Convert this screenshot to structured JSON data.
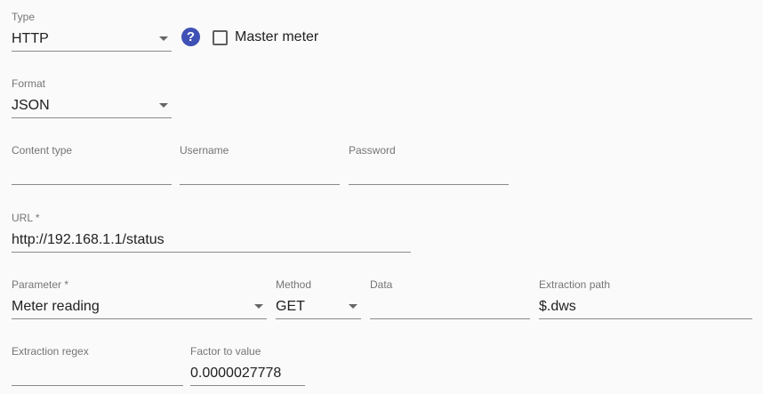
{
  "type": {
    "label": "Type",
    "value": "HTTP"
  },
  "help_icon": "?",
  "master_meter": {
    "label": "Master meter",
    "checked": false
  },
  "format": {
    "label": "Format",
    "value": "JSON"
  },
  "content_type": {
    "label": "Content type",
    "value": ""
  },
  "username": {
    "label": "Username",
    "value": ""
  },
  "password": {
    "label": "Password",
    "value": ""
  },
  "url": {
    "label": "URL *",
    "value": "http://192.168.1.1/status"
  },
  "parameter": {
    "label": "Parameter *",
    "value": "Meter reading"
  },
  "method": {
    "label": "Method",
    "value": "GET"
  },
  "data": {
    "label": "Data",
    "value": ""
  },
  "extraction_path": {
    "label": "Extraction path",
    "value": "$.dws"
  },
  "extraction_regex": {
    "label": "Extraction regex",
    "value": ""
  },
  "factor_to_value": {
    "label": "Factor to value",
    "value": "0.0000027778"
  },
  "colors": {
    "accent": "#3f51b5",
    "underline": "#8a8a8a",
    "label": "#757575",
    "text": "#212121"
  }
}
